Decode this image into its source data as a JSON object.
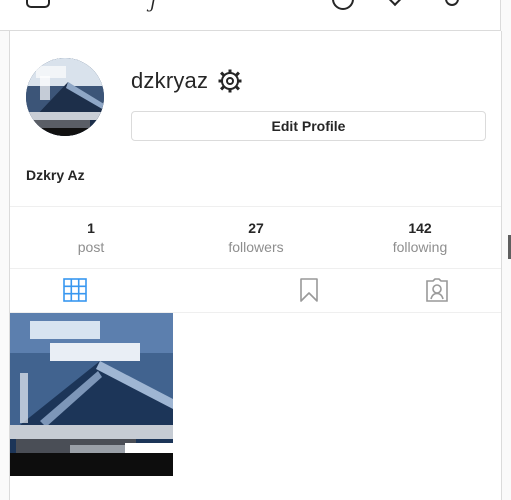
{
  "profile": {
    "username": "dzkryaz",
    "edit_profile_label": "Edit Profile",
    "full_name": "Dzkry Az"
  },
  "stats": [
    {
      "value": "1",
      "label": "post"
    },
    {
      "value": "27",
      "label": "followers"
    },
    {
      "value": "142",
      "label": "following"
    }
  ],
  "tabs": [
    {
      "icon": "grid-icon",
      "active": true
    },
    {
      "icon": "bookmark-icon",
      "active": false
    },
    {
      "icon": "tagged-icon",
      "active": false
    }
  ],
  "colors": {
    "accent": "#3897f0",
    "border": "#dbdbdb",
    "muted_text": "#8e8e8e",
    "text": "#262626",
    "icon_gray": "#999999"
  }
}
